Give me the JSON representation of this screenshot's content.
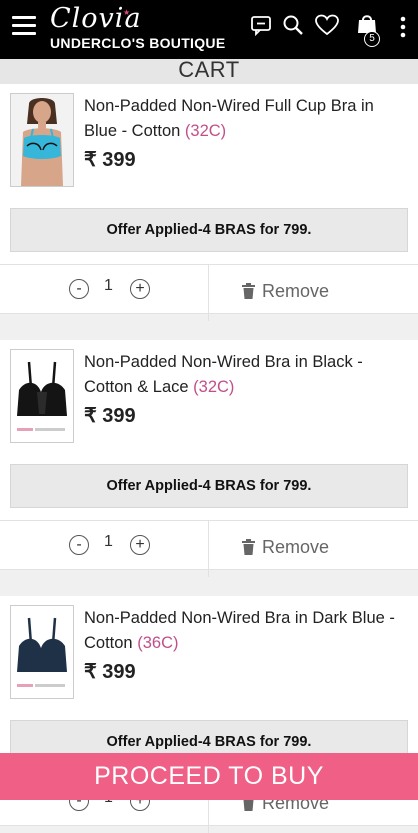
{
  "header": {
    "brand": "Clovia",
    "subtitle": "UNDERCLO'S BOUTIQUE",
    "cart_count": "5"
  },
  "page_title": "CART",
  "items": [
    {
      "name": "Non-Padded Non-Wired Full Cup Bra in Blue - Cotton",
      "size": "(32C)",
      "currency": "₹",
      "price": "399",
      "offer": "Offer Applied-4 BRAS for 799.",
      "qty_minus": "-",
      "qty": "1",
      "qty_plus": "+",
      "remove_label": "Remove",
      "image_colors": {
        "bra": "#36b6d8",
        "skin": "#d7a58a",
        "hair": "#4a3020"
      }
    },
    {
      "name": "Non-Padded Non-Wired Bra in Black - Cotton & Lace",
      "size": "(32C)",
      "currency": "₹",
      "price": "399",
      "offer": "Offer Applied-4 BRAS for 799.",
      "qty_minus": "-",
      "qty": "1",
      "qty_plus": "+",
      "remove_label": "Remove",
      "image_colors": {
        "bra": "#141414"
      }
    },
    {
      "name": "Non-Padded Non-Wired Bra in Dark Blue - Cotton",
      "size": "(36C)",
      "currency": "₹",
      "price": "399",
      "offer": "Offer Applied-4 BRAS for 799.",
      "qty_minus": "-",
      "qty": "1",
      "qty_plus": "+",
      "remove_label": "Remove",
      "image_colors": {
        "bra": "#1f3147"
      }
    }
  ],
  "proceed_label": "PROCEED TO BUY",
  "colors": {
    "accent": "#ef5f86",
    "size_text": "#c0508a",
    "header_bg": "#000000"
  }
}
